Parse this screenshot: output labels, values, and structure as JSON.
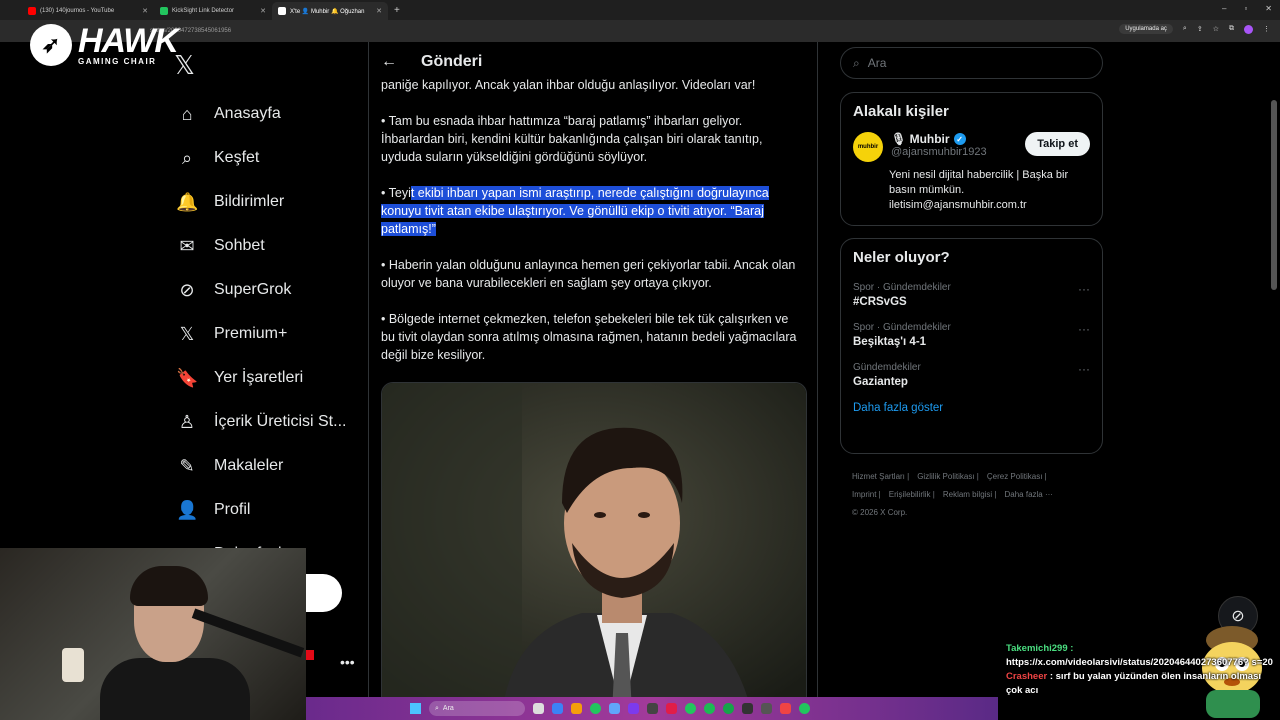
{
  "browser": {
    "tabs": [
      {
        "label": "(130) 140journos - YouTube",
        "color": "#ff0000"
      },
      {
        "label": "KickSight Link Detector",
        "color": "#22c55e"
      },
      {
        "label": "X'te 👤 Muhbir 🔔 Oğuzhan",
        "color": "#ffffff"
      }
    ],
    "url": "status/2020472738545061956",
    "app_pill": "Uygulamada aç"
  },
  "logo": {
    "name": "HAWK",
    "sub": "GAMING CHAIR"
  },
  "nav": {
    "items": [
      {
        "label": "Anasayfa",
        "icon": "home-icon",
        "glyph": "⌂"
      },
      {
        "label": "Keşfet",
        "icon": "search-icon",
        "glyph": "⌕"
      },
      {
        "label": "Bildirimler",
        "icon": "bell-icon",
        "glyph": "🔔"
      },
      {
        "label": "Sohbet",
        "icon": "mail-icon",
        "glyph": "✉"
      },
      {
        "label": "SuperGrok",
        "icon": "grok-icon",
        "glyph": "⊘"
      },
      {
        "label": "Premium+",
        "icon": "x-premium-icon",
        "glyph": "𝕏"
      },
      {
        "label": "Yer İşaretleri",
        "icon": "bookmark-icon",
        "glyph": "🔖"
      },
      {
        "label": "İçerik Üreticisi St...",
        "icon": "creator-icon",
        "glyph": "♙"
      },
      {
        "label": "Makaleler",
        "icon": "article-icon",
        "glyph": "✎"
      },
      {
        "label": "Profil",
        "icon": "profile-icon",
        "glyph": "👤"
      },
      {
        "label": "Daha fazla",
        "icon": "more-icon",
        "glyph": "⋯"
      }
    ]
  },
  "post": {
    "header": "Gönderi",
    "p0": "paniğe kapılıyor. Ancak yalan ihbar olduğu anlaşılıyor. Videoları var!",
    "p1": "• Tam bu esnada ihbar hattımıza “baraj patlamış” ihbarları geliyor. İhbarlardan biri, kendini kültür bakanlığında çalışan biri olarak tanıtıp, uyduda suların yükseldiğini gördüğünü söylüyor.",
    "p2_pre": "• Teyi",
    "p2_hl": "t ekibi ihbarı yapan ismi araştırıp, nerede çalıştığını doğrulayınca konuyu tivit atan ekibe ulaştırıyor. Ve gönüllü ekip o tiviti atıyor. “Baraj patlamış!”",
    "p3": "• Haberin yalan olduğunu anlayınca hemen geri çekiyorlar tabii. Ancak olan oluyor ve bana vurabilecekleri en sağlam şey ortaya çıkıyor.",
    "p4": "• Bölgede internet çekmezken, telefon şebekeleri bile tek tük çalışırken ve bu tivit olaydan sonra atılmış olmasına rağmen, hatanın bedeli yağmacılara değil bize kesiliyor."
  },
  "search": {
    "placeholder": "Ara"
  },
  "related": {
    "title": "Alakalı kişiler",
    "name": "🎙 Muhbir",
    "handle": "@ajansmuhbir1923",
    "avatar_text": "muhbir",
    "follow": "Takip et",
    "bio": "Yeni nesil dijital habercilik | Başka bir basın mümkün. iletisim@ajansmuhbir.com.tr"
  },
  "trends": {
    "title": "Neler oluyor?",
    "items": [
      {
        "meta": "Spor · Gündemdekiler",
        "name": "#CRSvGS"
      },
      {
        "meta": "Spor · Gündemdekiler",
        "name": "Beşiktaş'ı 4-1"
      },
      {
        "meta": "Gündemdekiler",
        "name": "Gaziantep"
      }
    ],
    "more": "Daha fazla göster"
  },
  "footer": {
    "links": [
      "Hizmet Şartları |",
      "Gizlilik Politikası |",
      "Çerez Politikası |",
      "Imprint |",
      "Erişilebilirlik |",
      "Reklam bilgisi |",
      "Daha fazla ···"
    ],
    "copyright": "© 2026 X Corp."
  },
  "taskbar": {
    "search": "Ara"
  },
  "chat": {
    "user1": "Takemichi299 :",
    "msg1": "https://x.com/videolarsivi/status/20204644027360776? s=20",
    "user2": "Crasheer",
    "msg2": ": sırf bu yalan yüzünden ölen insanların olması çok acı"
  }
}
